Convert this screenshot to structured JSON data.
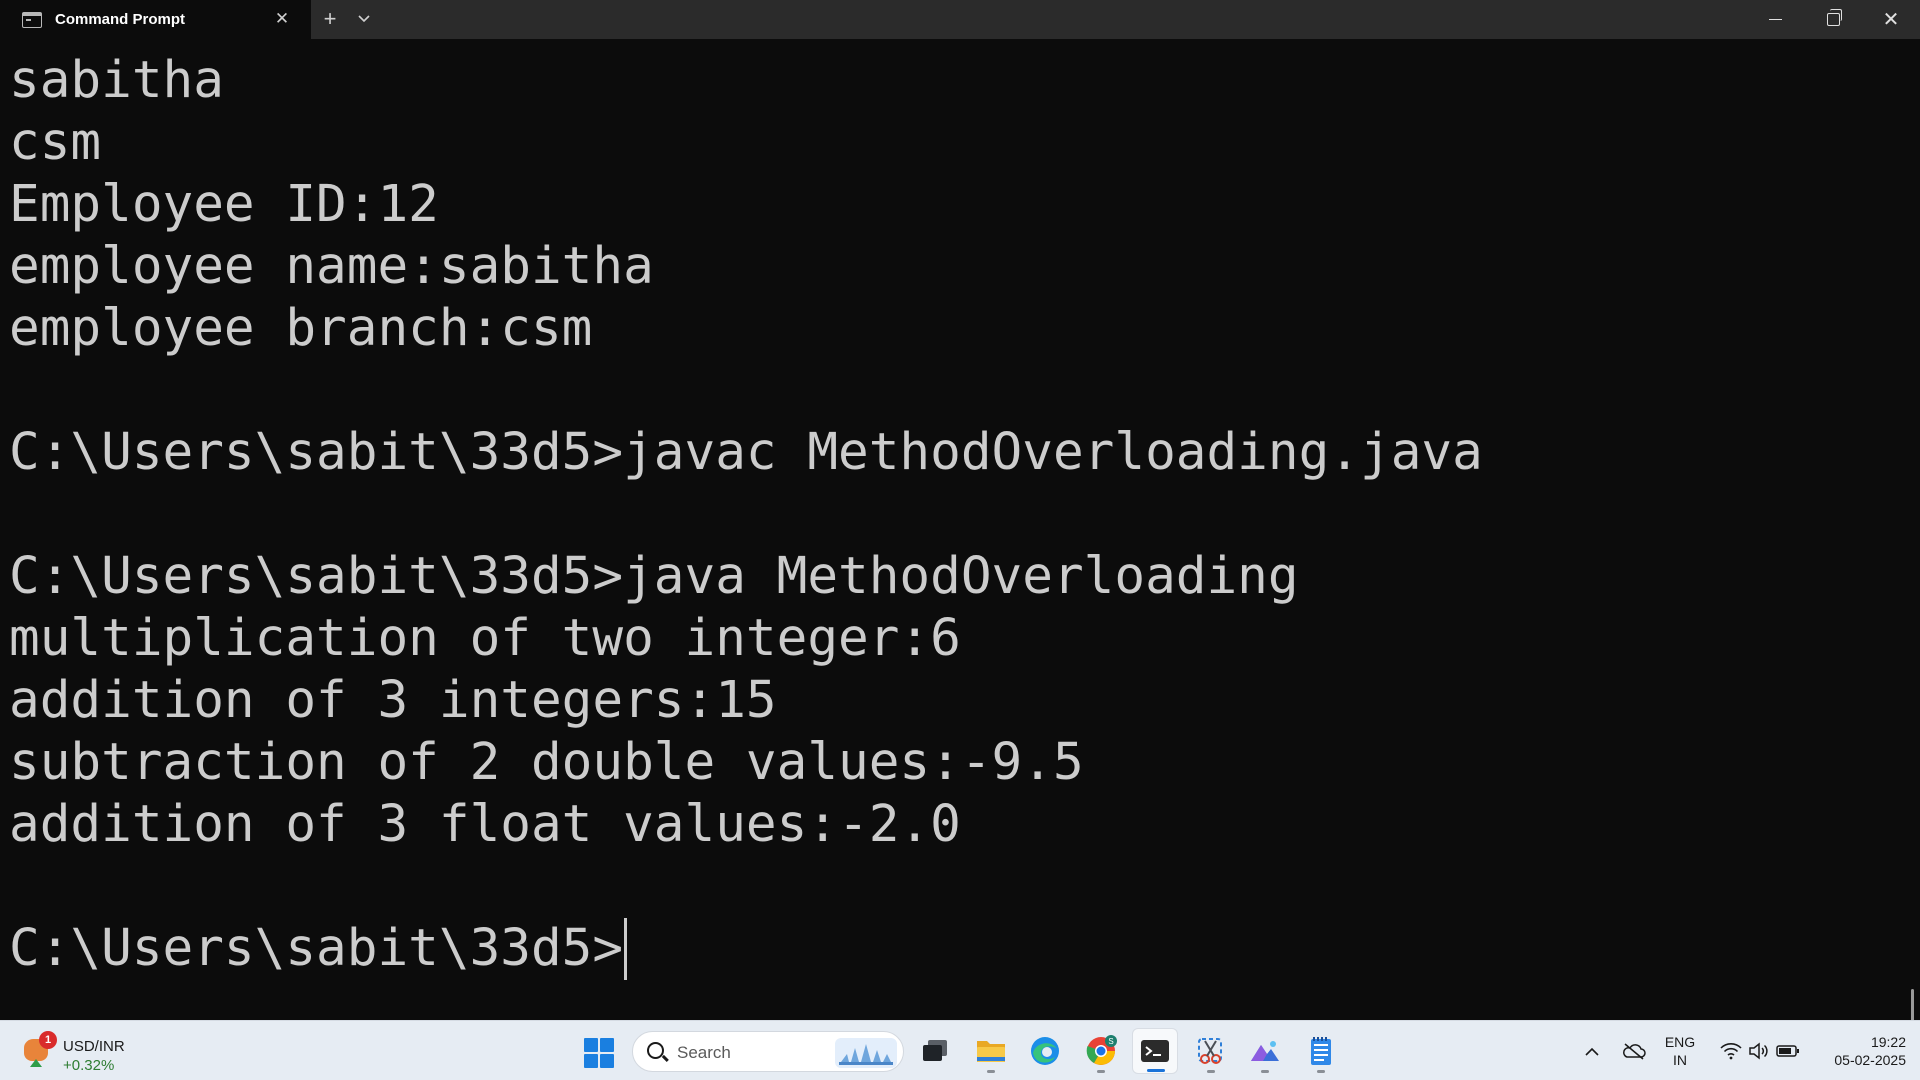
{
  "window": {
    "tab_title": "Command Prompt",
    "icons": {
      "tab": "terminal-icon",
      "close_tab": "close-icon",
      "new_tab": "plus-icon",
      "dropdown": "chevron-down-icon",
      "minimize": "minimize-icon",
      "maximize": "restore-icon",
      "close": "close-icon"
    },
    "close_glyph": "✕",
    "new_tab_glyph": "+",
    "dropdown_glyph": "⌄"
  },
  "terminal": {
    "lines": [
      "sabitha",
      "csm",
      "Employee ID:12",
      "employee name:sabitha",
      "employee branch:csm",
      "",
      "C:\\Users\\sabit\\33d5>javac MethodOverloading.java",
      "",
      "C:\\Users\\sabit\\33d5>java MethodOverloading",
      "multiplication of two integer:6",
      "addition of 3 integers:15",
      "subtraction of 2 double values:-9.5",
      "addition of 3 float values:-2.0",
      "",
      "C:\\Users\\sabit\\33d5>"
    ]
  },
  "taskbar": {
    "widget": {
      "badge": "1",
      "title": "USD/INR",
      "change": "+0.32%"
    },
    "search_placeholder": "Search",
    "apps": [
      "task-view-icon",
      "file-explorer-icon",
      "edge-icon",
      "chrome-icon",
      "terminal-icon",
      "snipping-tool-icon",
      "photos-icon",
      "notepad-icon"
    ],
    "tray": {
      "language_line1": "ENG",
      "language_line2": "IN",
      "time": "19:22",
      "date": "05-02-2025"
    }
  },
  "colors": {
    "terminal_bg": "#0c0c0c",
    "terminal_fg": "#cccccc",
    "titlebar_bg": "#2b2b2b",
    "taskbar_bg": "#e6ecf3",
    "accent": "#1a73d9"
  }
}
